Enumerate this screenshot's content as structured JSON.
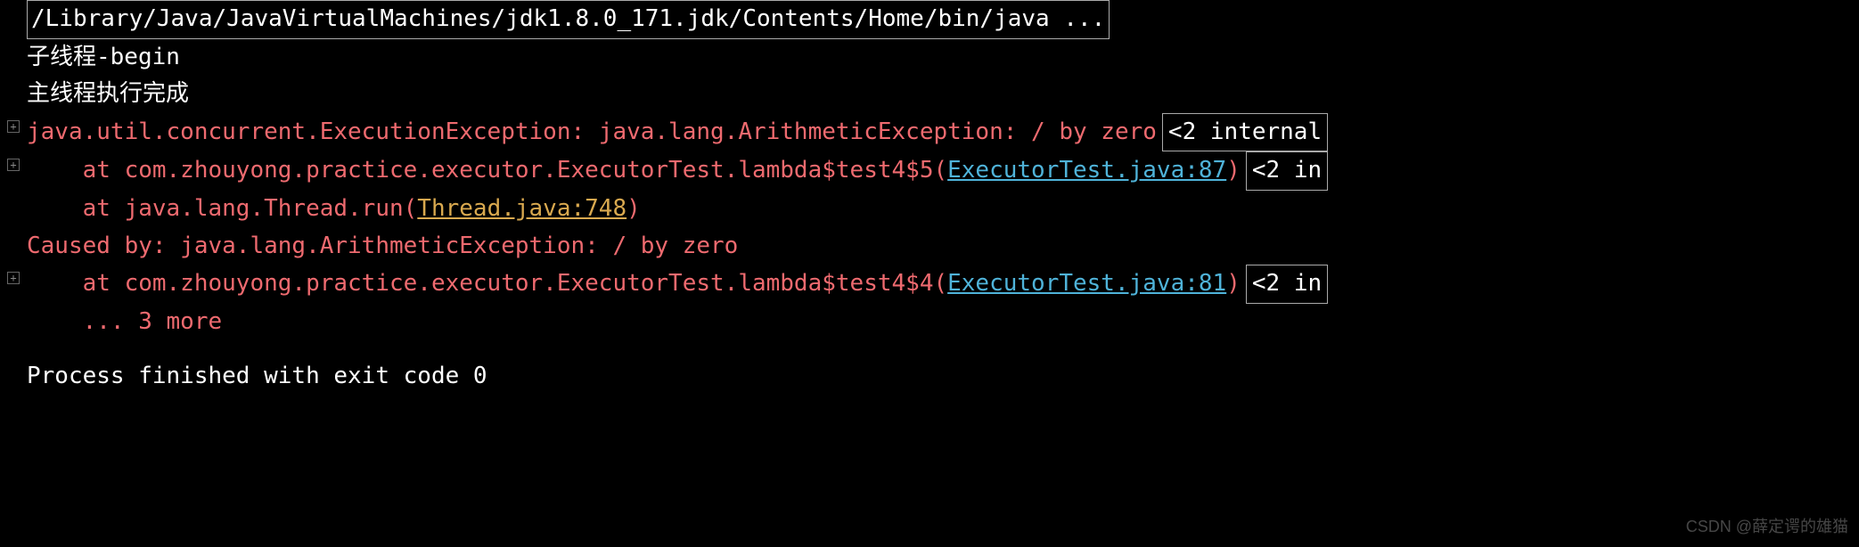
{
  "header": {
    "command": "/Library/Java/JavaVirtualMachines/jdk1.8.0_171.jdk/Contents/Home/bin/java ..."
  },
  "output": {
    "line1": "子线程-begin",
    "line2": "主线程执行完成"
  },
  "exception": {
    "line1_text": "java.util.concurrent.ExecutionException: java.lang.ArithmeticException: / by zero",
    "line1_badge": "<2 internal",
    "line2_prefix": "    at com.zhouyong.practice.executor.ExecutorTest.lambda$test4$5(",
    "line2_link": "ExecutorTest.java:87",
    "line2_suffix": ")",
    "line2_badge": "<2 in",
    "line3_prefix": "    at java.lang.Thread.run(",
    "line3_link": "Thread.java:748",
    "line3_suffix": ")",
    "line4_text": "Caused by: java.lang.ArithmeticException: / by zero",
    "line5_prefix": "    at com.zhouyong.practice.executor.ExecutorTest.lambda$test4$4(",
    "line5_link": "ExecutorTest.java:81",
    "line5_suffix": ")",
    "line5_badge": "<2 in",
    "line6_text": "    ... 3 more"
  },
  "footer": {
    "exit": "Process finished with exit code 0"
  },
  "watermark": "CSDN @薛定谔的雄猫",
  "fold_symbol": "+"
}
